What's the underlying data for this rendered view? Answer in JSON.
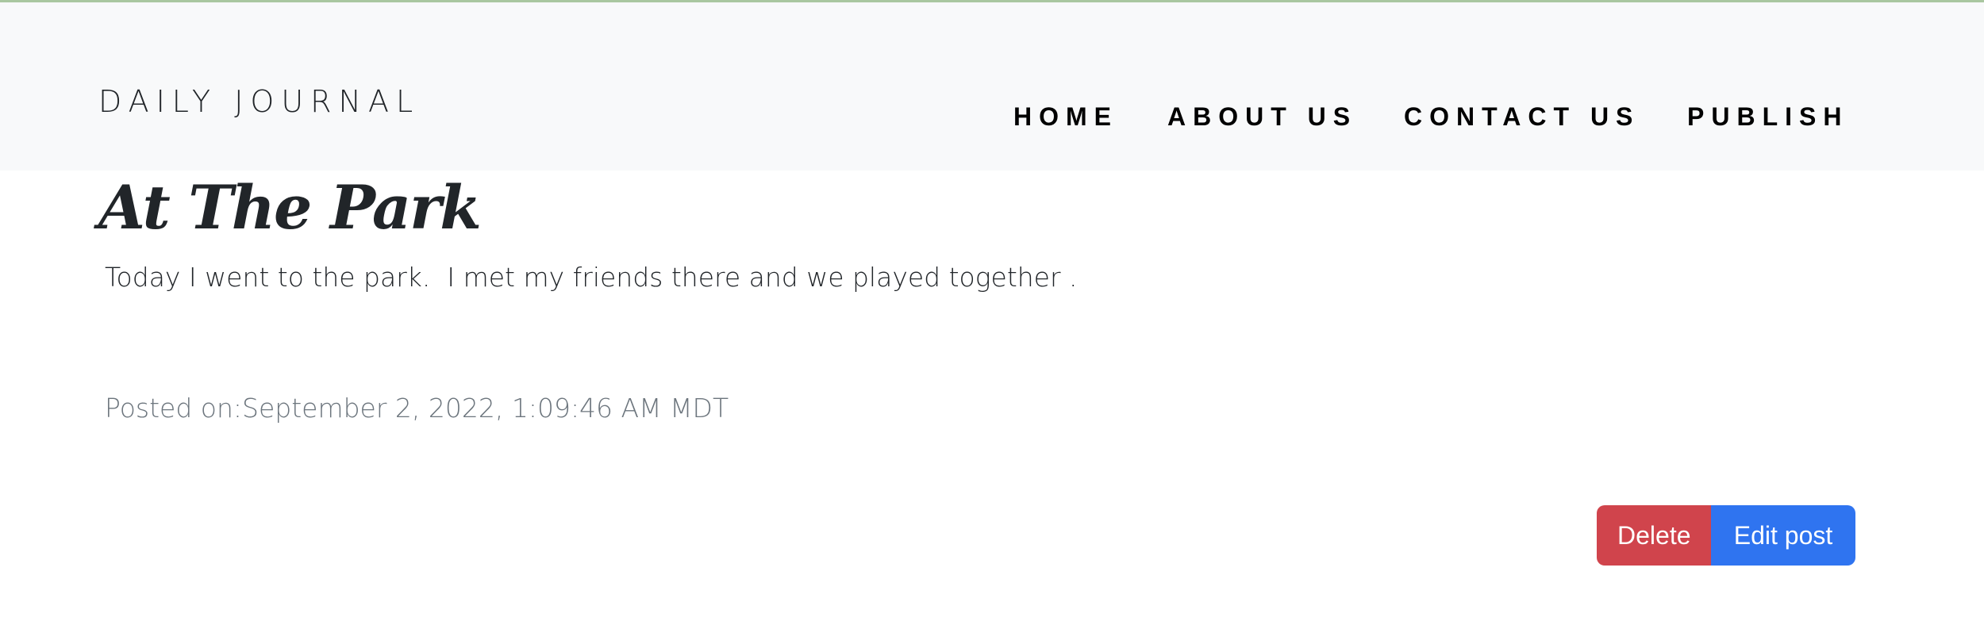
{
  "header": {
    "brand": "DAILY JOURNAL",
    "nav": {
      "home": "HOME",
      "about": "ABOUT US",
      "contact": "CONTACT US",
      "publish": "PUBLISH"
    }
  },
  "post": {
    "title": "At The Park",
    "body": "Today I went to the park.  I met my friends there and we played together .",
    "posted_on": "Posted on:September 2, 2022, 1:09:46 AM MDT"
  },
  "actions": {
    "delete_label": "Delete",
    "edit_label": "Edit post"
  },
  "colors": {
    "navbar_bg": "#f8f9fa",
    "delete": "#d0444c",
    "edit": "#2f74f0",
    "muted_text": "#6c757d"
  }
}
